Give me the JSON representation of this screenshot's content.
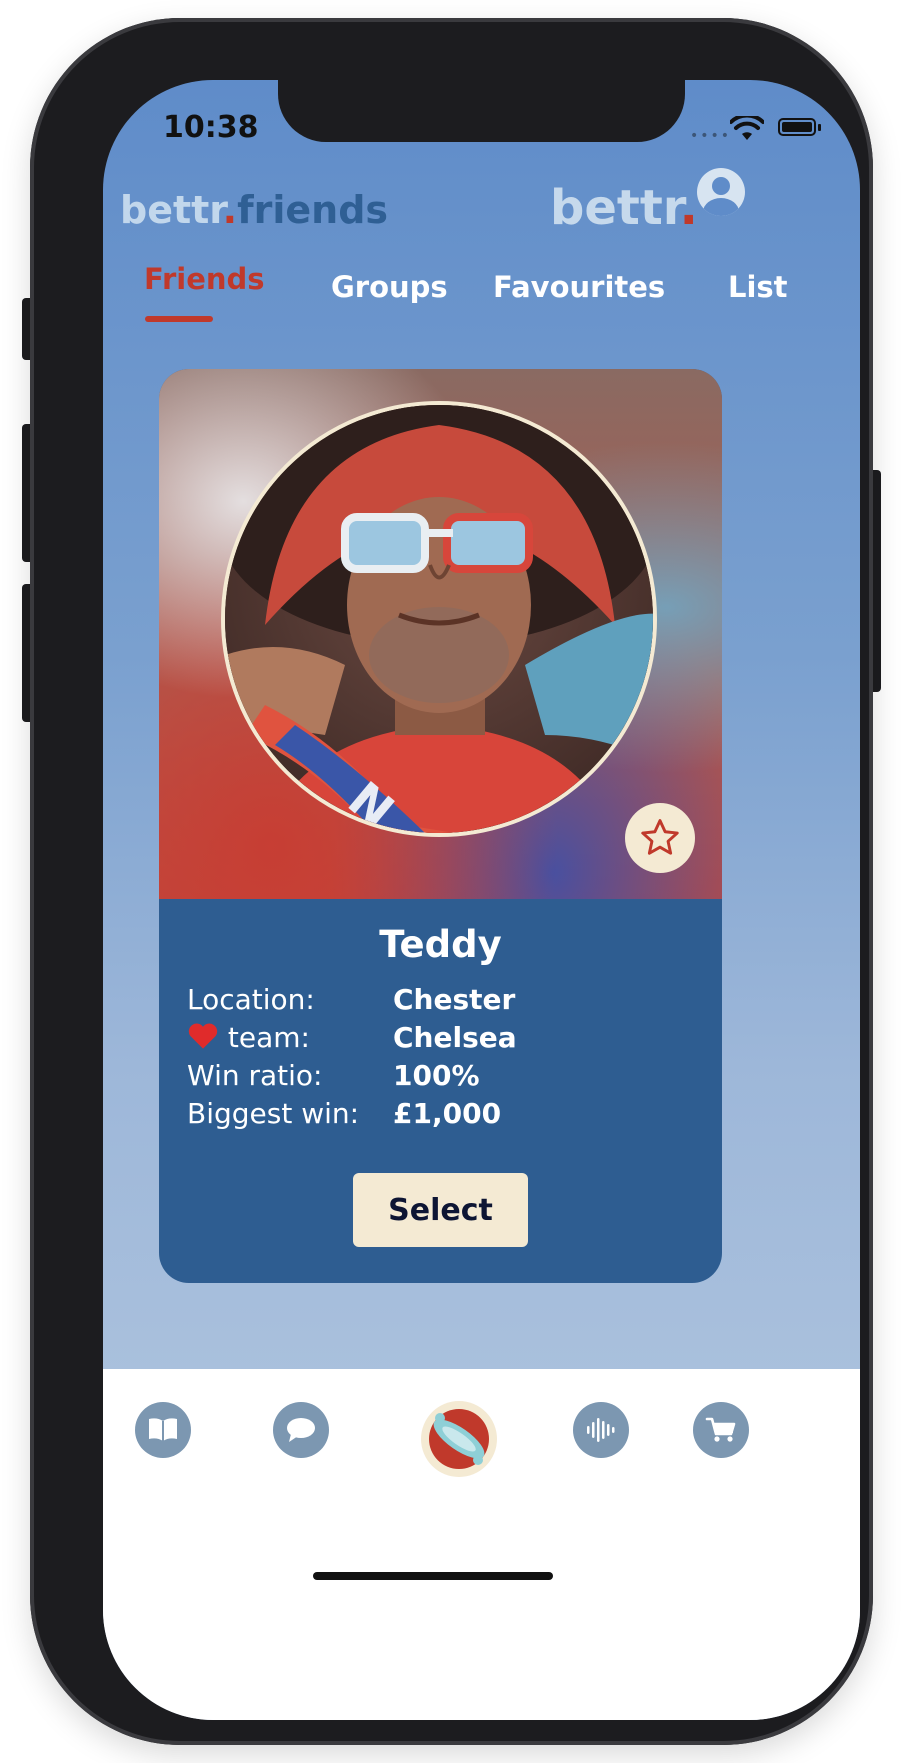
{
  "status_bar": {
    "time": "10:38"
  },
  "header": {
    "brand_left_part1": "bettr",
    "brand_left_dot": ".",
    "brand_left_part2": "friends",
    "brand_right": "bettr",
    "brand_right_dot": "."
  },
  "tabs": [
    {
      "label": "Friends",
      "active": true
    },
    {
      "label": "Groups",
      "active": false
    },
    {
      "label": "Favourites",
      "active": false
    },
    {
      "label": "List",
      "active": false
    }
  ],
  "profile": {
    "name": "Teddy",
    "stats": [
      {
        "label": "Location:",
        "value": "Chester"
      },
      {
        "label": "team:",
        "value": "Chelsea",
        "icon": "heart-icon"
      },
      {
        "label": "Win ratio:",
        "value": "100%"
      },
      {
        "label": "Biggest win:",
        "value": "£1,000"
      }
    ],
    "select_label": "Select",
    "favourite_icon": "star-outline-icon"
  },
  "bottom_nav": [
    {
      "icon": "book-icon"
    },
    {
      "icon": "chat-bubble-icon"
    },
    {
      "icon": "planet-logo-icon"
    },
    {
      "icon": "audio-wave-icon"
    },
    {
      "icon": "cart-icon"
    }
  ],
  "colors": {
    "accent": "#c0392b",
    "card": "#2e5d91",
    "cream": "#f4ead3",
    "nav_icon": "#7c97b1"
  }
}
